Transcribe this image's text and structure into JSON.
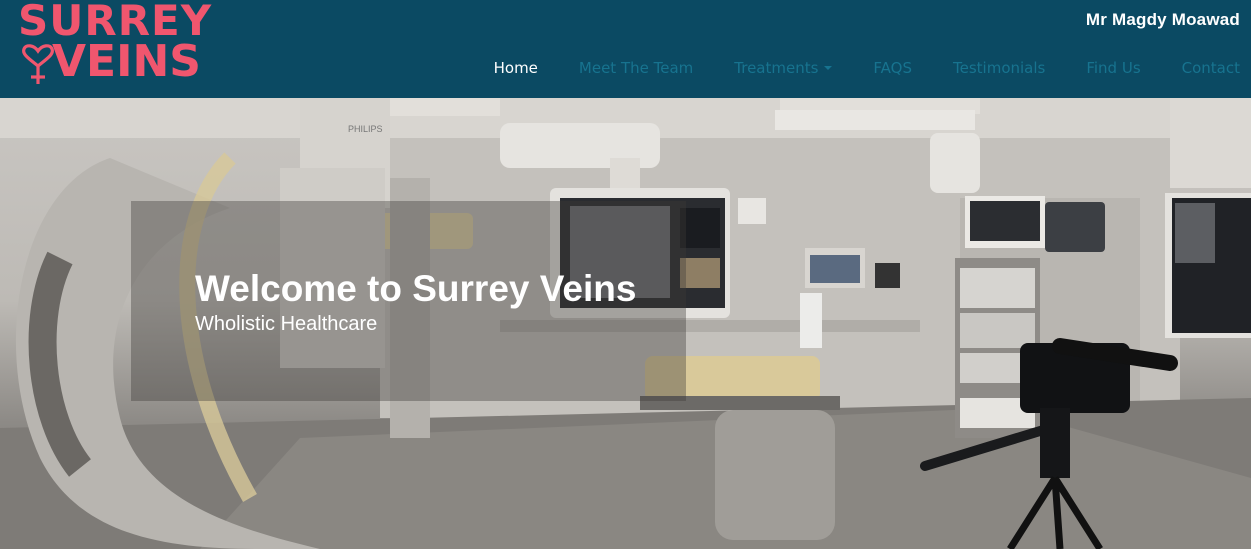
{
  "logo": {
    "line1": "SURREY",
    "line2": "VEINS"
  },
  "header": {
    "doctor_name": "Mr Magdy Moawad"
  },
  "nav": {
    "items": [
      {
        "label": "Home",
        "active": true
      },
      {
        "label": "Meet The Team",
        "active": false
      },
      {
        "label": "Treatments",
        "active": false,
        "has_dropdown": true
      },
      {
        "label": "FAQS",
        "active": false
      },
      {
        "label": "Testimonials",
        "active": false
      },
      {
        "label": "Find Us",
        "active": false
      },
      {
        "label": "Contact",
        "active": false
      }
    ]
  },
  "hero": {
    "title": "Welcome to Surrey Veins",
    "subtitle": "Wholistic Healthcare",
    "equipment_brand": "PHILIPS"
  },
  "colors": {
    "header_bg": "#0b4a63",
    "logo_pink": "#f0566e",
    "nav_link": "#17738f",
    "nav_active": "#ffffff"
  }
}
